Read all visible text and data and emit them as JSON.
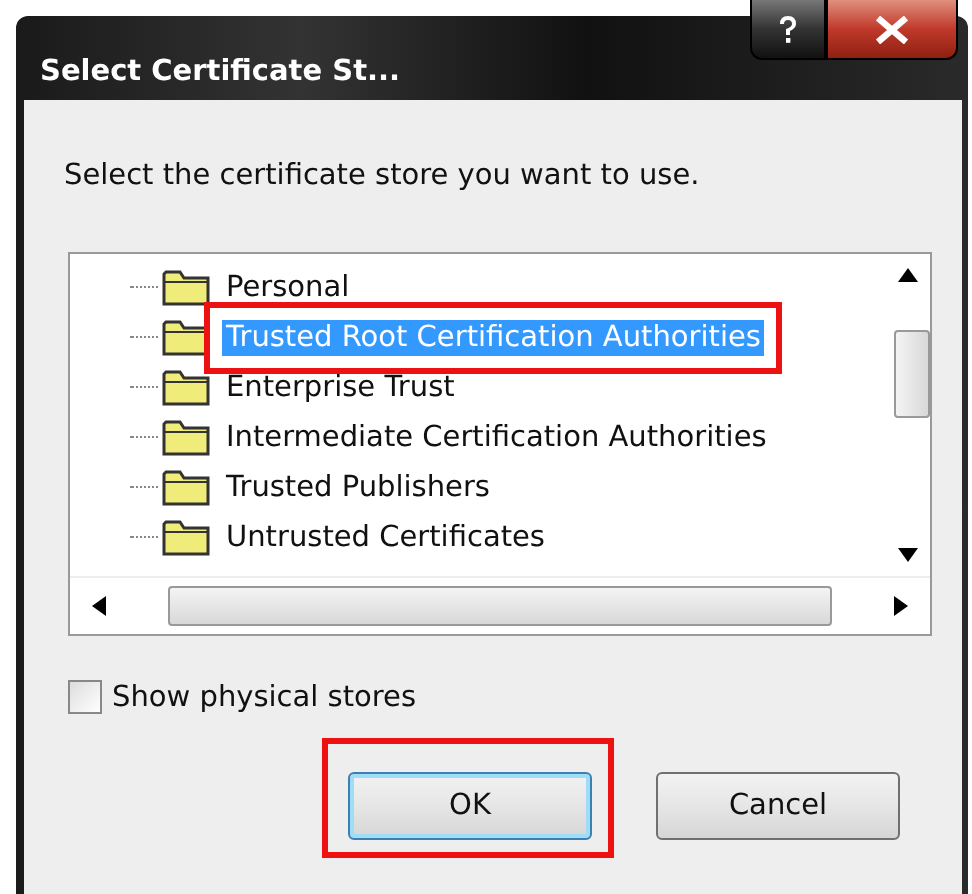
{
  "window": {
    "title": "Select Certificate St..."
  },
  "prompt": "Select the certificate store you want to use.",
  "tree": {
    "items": [
      {
        "label": "Personal",
        "selected": false,
        "highlighted": false
      },
      {
        "label": "Trusted Root Certification Authorities",
        "selected": true,
        "highlighted": true
      },
      {
        "label": "Enterprise Trust",
        "selected": false,
        "highlighted": false
      },
      {
        "label": "Intermediate Certification Authorities",
        "selected": false,
        "highlighted": false
      },
      {
        "label": "Trusted Publishers",
        "selected": false,
        "highlighted": false
      },
      {
        "label": "Untrusted Certificates",
        "selected": false,
        "highlighted": false
      }
    ]
  },
  "show_physical_stores": {
    "label": "Show physical stores",
    "checked": false
  },
  "buttons": [
    {
      "label": "OK",
      "kind": "default",
      "highlighted": true
    },
    {
      "label": "Cancel",
      "kind": "normal",
      "highlighted": false
    }
  ]
}
